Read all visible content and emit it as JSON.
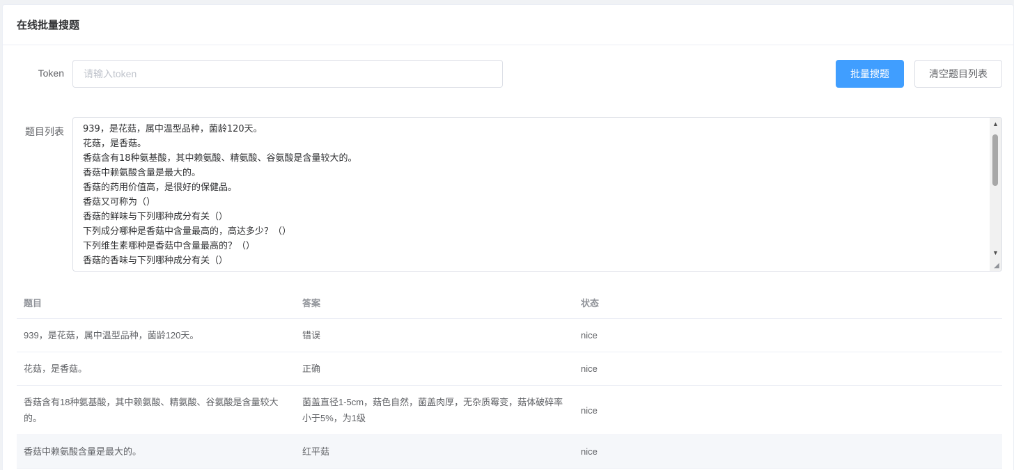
{
  "header": {
    "title": "在线批量搜题"
  },
  "form": {
    "token_label": "Token",
    "token_placeholder": "请输入token",
    "token_value": "",
    "search_button": "批量搜题",
    "clear_button": "清空题目列表",
    "questions_label": "题目列表",
    "question_lines": [
      "939，是花菇，属中温型品种，菌龄120天。",
      "花菇，是香菇。",
      "香菇含有18种氨基酸，其中赖氨酸、精氨酸、谷氨酸是含量较大的。",
      "香菇中赖氨酸含量是最大的。",
      "香菇的药用价值高，是很好的保健品。",
      "香菇又可称为（）",
      "香菇的鲜味与下列哪种成分有关（）",
      "下列成分哪种是香菇中含量最高的，高达多少？（）",
      "下列维生素哪种是香菇中含量最高的？（）",
      "香菇的香味与下列哪种成分有关（）"
    ]
  },
  "table": {
    "headers": [
      "题目",
      "答案",
      "状态"
    ],
    "rows": [
      {
        "question": "939，是花菇，属中温型品种，菌龄120天。",
        "answer": "错误",
        "status": "nice"
      },
      {
        "question": "花菇，是香菇。",
        "answer": "正确",
        "status": "nice"
      },
      {
        "question": "香菇含有18种氨基酸，其中赖氨酸、精氨酸、谷氨酸是含量较大的。",
        "answer": "菌盖直径1-5cm，菇色自然，菌盖肉厚，无杂质霉变，菇体破碎率小于5%，为1级",
        "status": "nice"
      },
      {
        "question": "香菇中赖氨酸含量是最大的。",
        "answer": "红平菇",
        "status": "nice"
      }
    ]
  },
  "colors": {
    "primary": "#409eff",
    "border": "#dcdfe6",
    "stripe": "#f5f7fa"
  }
}
